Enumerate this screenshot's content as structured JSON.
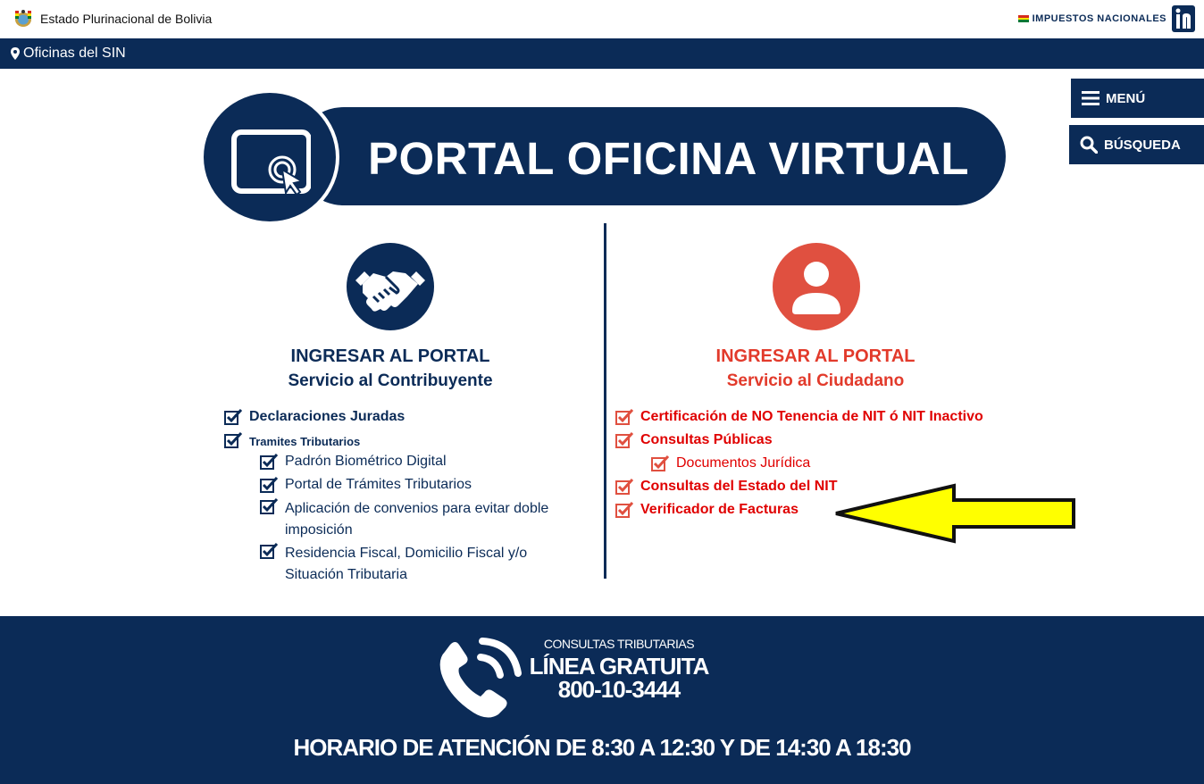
{
  "header": {
    "state_name": "Estado Plurinacional de Bolivia",
    "logo_text": "IMPUESTOS NACIONALES"
  },
  "officebar": {
    "link_label": "Oficinas del SIN"
  },
  "sidebar": {
    "menu_label": "MENÚ",
    "search_label": "BÚSQUEDA"
  },
  "banner": {
    "title": "PORTAL OFICINA VIRTUAL"
  },
  "left_column": {
    "title": "INGRESAR AL PORTAL",
    "subtitle": "Servicio al Contribuyente",
    "items": [
      {
        "label": "Declaraciones Juradas"
      },
      {
        "label": "Tramites Tributarios"
      }
    ],
    "subitems": [
      {
        "label": "Padrón Biométrico Digital"
      },
      {
        "label": "Portal de Trámites Tributarios"
      },
      {
        "label": "Aplicación de convenios para evitar doble imposición"
      },
      {
        "label": "Residencia Fiscal, Domicilio Fiscal y/o Situación Tributaria"
      }
    ]
  },
  "right_column": {
    "title": "INGRESAR AL PORTAL",
    "subtitle": "Servicio al Ciudadano",
    "items": [
      {
        "label": "Certificación de NO Tenencia de NIT ó NIT Inactivo"
      },
      {
        "label": "Consultas Públicas"
      },
      {
        "label": "Documentos Jurídica"
      },
      {
        "label": "Consultas del Estado del NIT"
      },
      {
        "label": "Verificador de Facturas"
      }
    ]
  },
  "footer": {
    "small_label": "CONSULTAS TRIBUTARIAS",
    "line_label": "LÍNEA GRATUITA",
    "phone_number": "800-10-3444",
    "hours": "HORARIO DE ATENCIÓN DE 8:30 A 12:30 Y DE 14:30 A 18:30"
  },
  "colors": {
    "navy": "#0b2b57",
    "red": "#e00000",
    "coral": "#e05040",
    "arrow_yellow": "#ffff00"
  },
  "icons": [
    "bolivia-seal-icon",
    "map-pin-icon",
    "hamburger-menu-icon",
    "search-icon",
    "virtual-office-icon",
    "handshake-icon",
    "user-icon",
    "checkbox-icon",
    "phone-icon",
    "arrow-pointer-icon"
  ]
}
